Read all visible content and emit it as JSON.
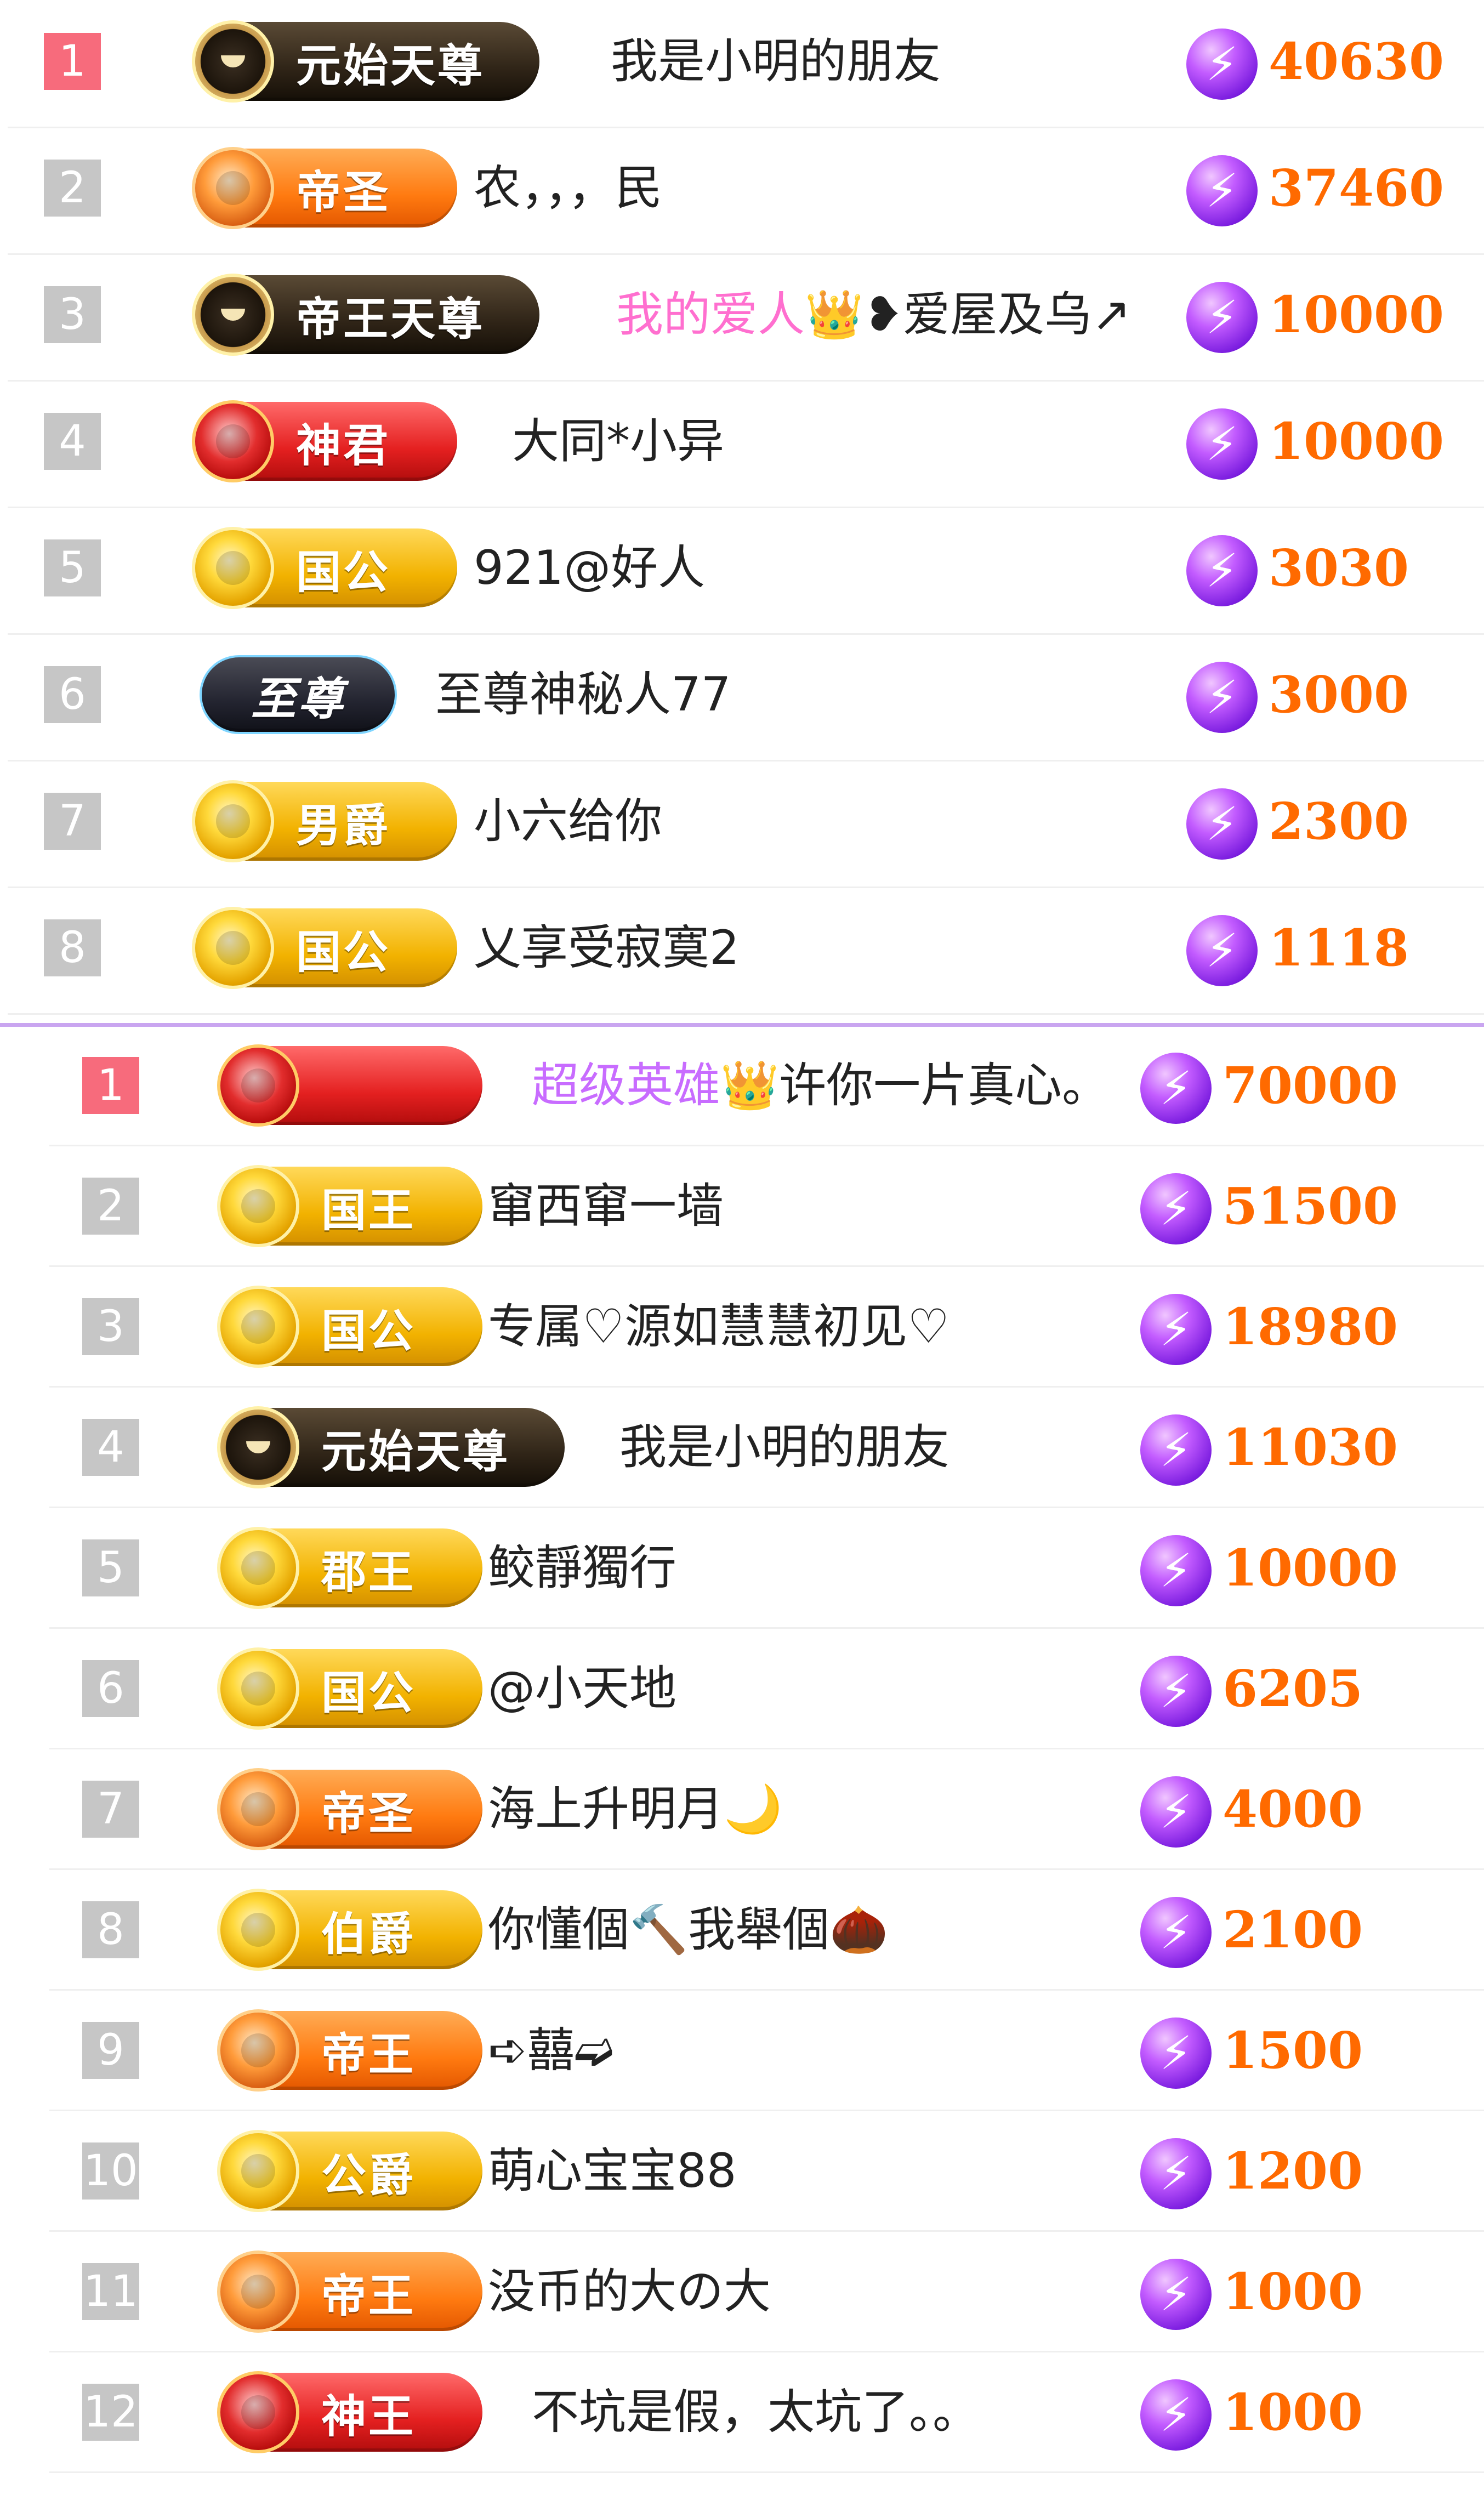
{
  "top_board": {
    "rows": [
      {
        "rank": "1",
        "title": "元始天尊",
        "name_parts": [
          {
            "text": "我是小明的朋友",
            "color": "default"
          }
        ],
        "score": "40630"
      },
      {
        "rank": "2",
        "title": "帝圣",
        "name_parts": [
          {
            "text": "农，，，民",
            "color": "default"
          }
        ],
        "score": "37460"
      },
      {
        "rank": "3",
        "title": "帝王天尊",
        "name_parts": [
          {
            "text": "我的爱人",
            "color": "pink"
          },
          {
            "text": "👑❥爱屋及乌↗",
            "color": "default"
          }
        ],
        "score": "10000"
      },
      {
        "rank": "4",
        "title": "神君",
        "name_parts": [
          {
            "text": "大同*小异",
            "color": "default"
          }
        ],
        "score": "10000"
      },
      {
        "rank": "5",
        "title": "国公",
        "name_parts": [
          {
            "text": "921@好人",
            "color": "default"
          }
        ],
        "score": "3030"
      },
      {
        "rank": "6",
        "title": "至尊",
        "name_parts": [
          {
            "text": "至尊神秘人77",
            "color": "default"
          }
        ],
        "score": "3000"
      },
      {
        "rank": "7",
        "title": "男爵",
        "name_parts": [
          {
            "text": "小六给你",
            "color": "default"
          }
        ],
        "score": "2300"
      },
      {
        "rank": "8",
        "title": "国公",
        "name_parts": [
          {
            "text": "乂享受寂寞2",
            "color": "default"
          }
        ],
        "score": "1118"
      }
    ]
  },
  "bottom_board": {
    "rows": [
      {
        "rank": "1",
        "title": "",
        "name_parts": [
          {
            "text": "超级英雄",
            "color": "violet"
          },
          {
            "text": "👑许你一片真心。",
            "color": "default"
          }
        ],
        "score": "70000"
      },
      {
        "rank": "2",
        "title": "国王",
        "name_parts": [
          {
            "text": "窜西窜一墙",
            "color": "default"
          }
        ],
        "score": "51500"
      },
      {
        "rank": "3",
        "title": "国公",
        "name_parts": [
          {
            "text": "专属♡源如慧慧初见♡",
            "color": "default"
          }
        ],
        "score": "18980"
      },
      {
        "rank": "4",
        "title": "元始天尊",
        "name_parts": [
          {
            "text": "我是小明的朋友",
            "color": "default"
          }
        ],
        "score": "11030"
      },
      {
        "rank": "5",
        "title": "郡王",
        "name_parts": [
          {
            "text": "鲛靜獨行",
            "color": "default"
          }
        ],
        "score": "10000"
      },
      {
        "rank": "6",
        "title": "国公",
        "name_parts": [
          {
            "text": "@小天地",
            "color": "default"
          }
        ],
        "score": "6205"
      },
      {
        "rank": "7",
        "title": "帝圣",
        "name_parts": [
          {
            "text": "海上升明月🌙",
            "color": "default"
          }
        ],
        "score": "4000"
      },
      {
        "rank": "8",
        "title": "伯爵",
        "name_parts": [
          {
            "text": "你懂個🔨我舉個🌰",
            "color": "default"
          }
        ],
        "score": "2100"
      },
      {
        "rank": "9",
        "title": "帝王",
        "name_parts": [
          {
            "text": "➪囍➫",
            "color": "default"
          }
        ],
        "score": "1500"
      },
      {
        "rank": "10",
        "title": "公爵",
        "name_parts": [
          {
            "text": "萌心宝宝88",
            "color": "default"
          }
        ],
        "score": "1200"
      },
      {
        "rank": "11",
        "title": "帝王",
        "name_parts": [
          {
            "text": "没币的大の大",
            "color": "default"
          }
        ],
        "score": "1000"
      },
      {
        "rank": "12",
        "title": "神王",
        "name_parts": [
          {
            "text": "不坑是假，太坑了。。",
            "color": "default"
          }
        ],
        "score": "1000"
      }
    ]
  },
  "icons": {
    "gem": "lightning-gem-icon",
    "emblem": "rank-emblem-icon"
  },
  "colors": {
    "score": "#ff6a00",
    "first_rank_bg": "#f76b7c",
    "rank_bg": "#c6c6c6",
    "pink_name": "#ff6fcf",
    "violet_name": "#c86cff",
    "divider": "#c9a5f0"
  }
}
